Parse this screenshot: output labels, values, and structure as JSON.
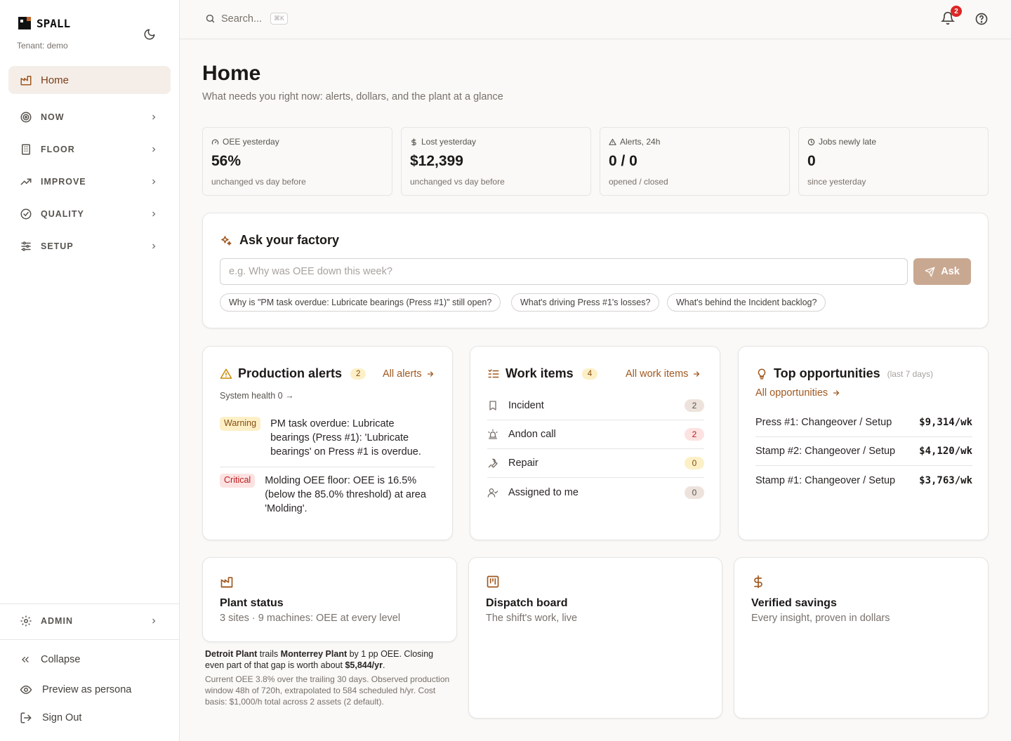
{
  "brand": {
    "name": "SPALL",
    "tenant": "Tenant: demo"
  },
  "colors": {
    "accent": "#a0581f",
    "active_bg": "#f5eee8",
    "ask_button": "#c9a891",
    "badge_red": "#dc2626"
  },
  "sidebar": {
    "home": "Home",
    "items": [
      {
        "label": "NOW",
        "icon": "radar-icon"
      },
      {
        "label": "FLOOR",
        "icon": "building-icon"
      },
      {
        "label": "IMPROVE",
        "icon": "trending-up-icon"
      },
      {
        "label": "QUALITY",
        "icon": "check-circle-icon"
      },
      {
        "label": "SETUP",
        "icon": "sliders-icon"
      }
    ],
    "admin": "ADMIN",
    "collapse": "Collapse",
    "preview": "Preview as persona",
    "signout": "Sign Out"
  },
  "topbar": {
    "search_placeholder": "Search...",
    "shortcut": "⌘K",
    "notifications": "2"
  },
  "page": {
    "title": "Home",
    "subtitle": "What needs you right now: alerts, dollars, and the plant at a glance"
  },
  "kpis": [
    {
      "label": "OEE yesterday",
      "value": "56%",
      "note": "unchanged vs day before",
      "icon": "gauge-icon"
    },
    {
      "label": "Lost yesterday",
      "value": "$12,399",
      "note": "unchanged vs day before",
      "icon": "dollar-icon"
    },
    {
      "label": "Alerts, 24h",
      "value": "0 / 0",
      "note": "opened / closed",
      "icon": "warning-icon"
    },
    {
      "label": "Jobs newly late",
      "value": "0",
      "note": "since yesterday",
      "icon": "clock-icon"
    }
  ],
  "ask": {
    "title": "Ask your factory",
    "placeholder": "e.g. Why was OEE down this week?",
    "button": "Ask",
    "suggestions": [
      "Why is \"PM task overdue: Lubricate bearings (Press #1)\" still open?",
      "What's driving Press #1's losses?",
      "What's behind the Incident backlog?"
    ]
  },
  "alerts": {
    "title": "Production alerts",
    "count": "2",
    "link": "All alerts",
    "system_health": "System health 0",
    "items": [
      {
        "severity": "Warning",
        "text": "PM task overdue: Lubricate bearings (Press #1): 'Lubricate bearings' on Press #1 is overdue."
      },
      {
        "severity": "Critical",
        "text": "Molding OEE floor: OEE is 16.5% (below the 85.0% threshold) at area 'Molding'."
      }
    ]
  },
  "work_items": {
    "title": "Work items",
    "count": "4",
    "link": "All work items",
    "items": [
      {
        "label": "Incident",
        "count": "2",
        "icon": "bookmark-icon"
      },
      {
        "label": "Andon call",
        "count": "2",
        "icon": "siren-icon"
      },
      {
        "label": "Repair",
        "count": "0",
        "icon": "wrench-icon"
      },
      {
        "label": "Assigned to me",
        "count": "0",
        "icon": "user-check-icon"
      }
    ]
  },
  "opportunities": {
    "title": "Top opportunities",
    "period": "(last 7 days)",
    "link": "All opportunities",
    "items": [
      {
        "name": "Press #1: Changeover / Setup",
        "value": "$9,314/wk"
      },
      {
        "name": "Stamp #2: Changeover / Setup",
        "value": "$4,120/wk"
      },
      {
        "name": "Stamp #1: Changeover / Setup",
        "value": "$3,763/wk"
      }
    ]
  },
  "tiles": [
    {
      "title": "Plant status",
      "subtitle": "3 sites · 9 machines: OEE at every level",
      "icon": "factory-icon"
    },
    {
      "title": "Dispatch board",
      "subtitle": "The shift's work, live",
      "icon": "kanban-icon"
    },
    {
      "title": "Verified savings",
      "subtitle": "Every insight, proven in dollars",
      "icon": "dollar-icon"
    }
  ],
  "plant_note": {
    "plant_a": "Detroit Plant",
    "trails": " trails ",
    "plant_b": "Monterrey Plant",
    "middle": " by 1 pp OEE. Closing even part of that gap is worth about ",
    "value": "$5,844/yr",
    "end": ".",
    "detail": "Current OEE 3.8% over the trailing 30 days. Observed production window 48h of 720h, extrapolated to 584 scheduled h/yr. Cost basis: $1,000/h total across 2 assets (2 default)."
  }
}
